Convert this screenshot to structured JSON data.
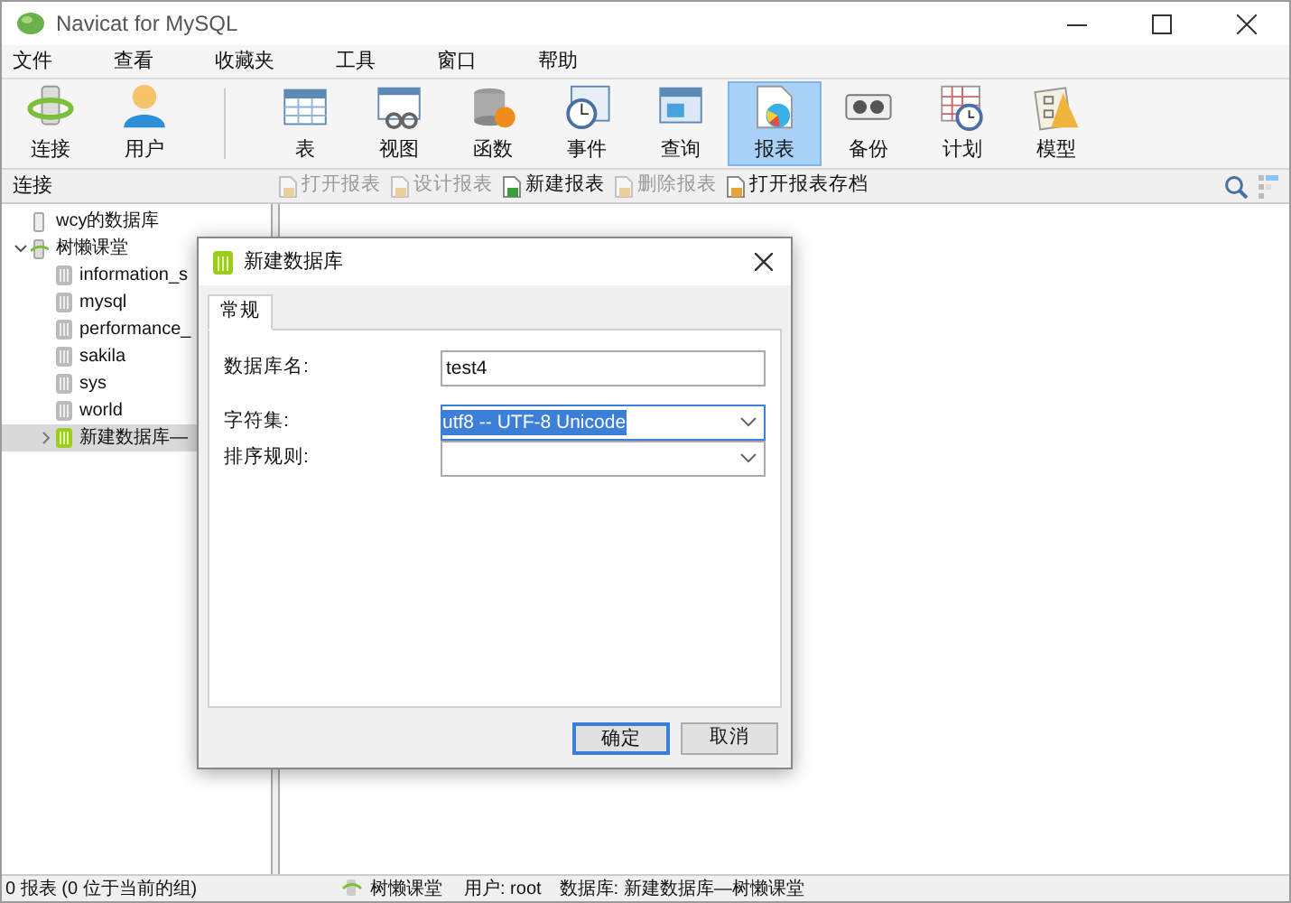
{
  "window": {
    "title": "Navicat for MySQL"
  },
  "menu": [
    "文件",
    "查看",
    "收藏夹",
    "工具",
    "窗口",
    "帮助"
  ],
  "toolbar": [
    {
      "label": "连接",
      "selected": false
    },
    {
      "label": "用户",
      "selected": false
    },
    {
      "label": "表",
      "selected": false
    },
    {
      "label": "视图",
      "selected": false
    },
    {
      "label": "函数",
      "selected": false
    },
    {
      "label": "事件",
      "selected": false
    },
    {
      "label": "查询",
      "selected": false
    },
    {
      "label": "报表",
      "selected": true
    },
    {
      "label": "备份",
      "selected": false
    },
    {
      "label": "计划",
      "selected": false
    },
    {
      "label": "模型",
      "selected": false
    }
  ],
  "subbar": {
    "title": "连接",
    "actions": [
      {
        "label": "打开报表",
        "disabled": true
      },
      {
        "label": "设计报表",
        "disabled": true
      },
      {
        "label": "新建报表",
        "disabled": false
      },
      {
        "label": "删除报表",
        "disabled": true
      },
      {
        "label": "打开报表存档",
        "disabled": false
      }
    ]
  },
  "sidebar": {
    "items": [
      {
        "label": "wcy的数据库",
        "kind": "connection",
        "expanded": false,
        "selected": false
      },
      {
        "label": "树懒课堂",
        "kind": "connection",
        "expanded": true,
        "selected": false,
        "children": [
          {
            "label": "information_s",
            "kind": "database",
            "selected": false
          },
          {
            "label": "mysql",
            "kind": "database",
            "selected": false
          },
          {
            "label": "performance_",
            "kind": "database",
            "selected": false
          },
          {
            "label": "sakila",
            "kind": "database",
            "selected": false
          },
          {
            "label": "sys",
            "kind": "database",
            "selected": false
          },
          {
            "label": "world",
            "kind": "database",
            "selected": false
          },
          {
            "label": "新建数据库—",
            "kind": "database-open",
            "selected": true,
            "expanded": false
          }
        ]
      }
    ]
  },
  "dialog": {
    "title": "新建数据库",
    "tabs": [
      {
        "label": "常规",
        "selected": true
      }
    ],
    "fields": [
      {
        "label": "数据库名:",
        "kind": "input",
        "value": "test4",
        "focused": false
      },
      {
        "label": "字符集:",
        "kind": "select",
        "value": "utf8 -- UTF-8 Unicode",
        "focused": true
      },
      {
        "label": "排序规则:",
        "kind": "select",
        "focused": false
      }
    ],
    "buttons": [
      {
        "label": "确定",
        "default": true
      },
      {
        "label": "取消",
        "default": false
      }
    ]
  },
  "status_bar": {
    "left": "0 报表 (0 位于当前的组)",
    "connection": "树懒课堂",
    "user": "用户: root",
    "database": "数据库: 新建数据库—树懒课堂"
  }
}
